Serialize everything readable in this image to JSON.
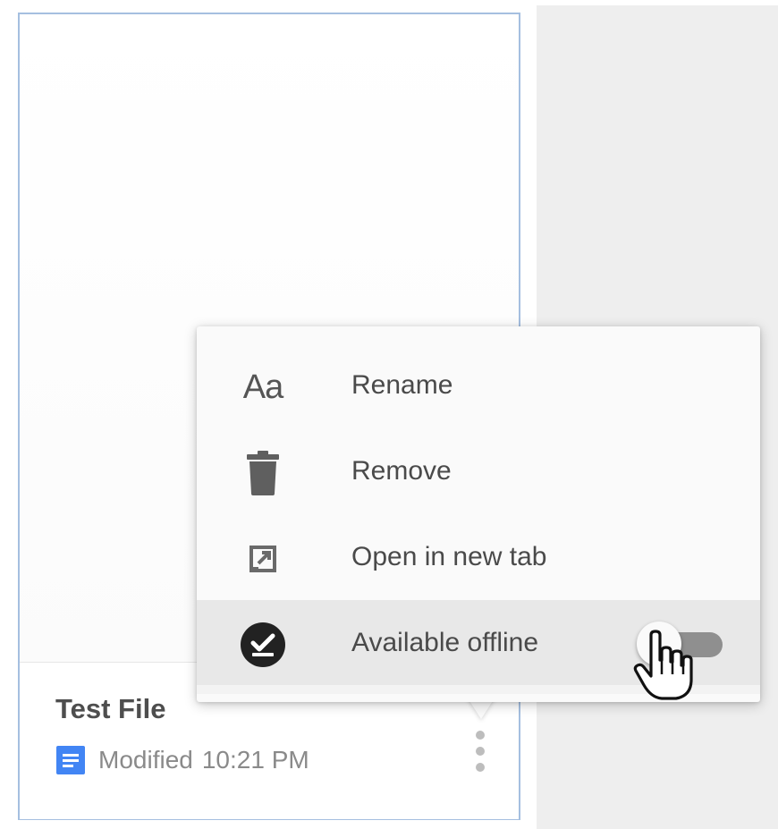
{
  "file_card": {
    "title": "Test File",
    "modified_label": "Modified",
    "modified_time": "10:21 PM",
    "file_type_icon": "docs-file-icon",
    "more_icon": "more-vert-icon"
  },
  "context_menu": {
    "items": [
      {
        "label": "Rename",
        "icon": "rename-aa-icon"
      },
      {
        "label": "Remove",
        "icon": "trash-icon"
      },
      {
        "label": "Open in new tab",
        "icon": "open-in-new-icon"
      },
      {
        "label": "Available offline",
        "icon": "offline-check-icon",
        "toggle_on": false
      }
    ]
  },
  "colors": {
    "card_border": "#a5bfe0",
    "docs_blue": "#4285f4",
    "highlight": "#e8e8e8",
    "toggle_track": "#8f8f8f"
  }
}
